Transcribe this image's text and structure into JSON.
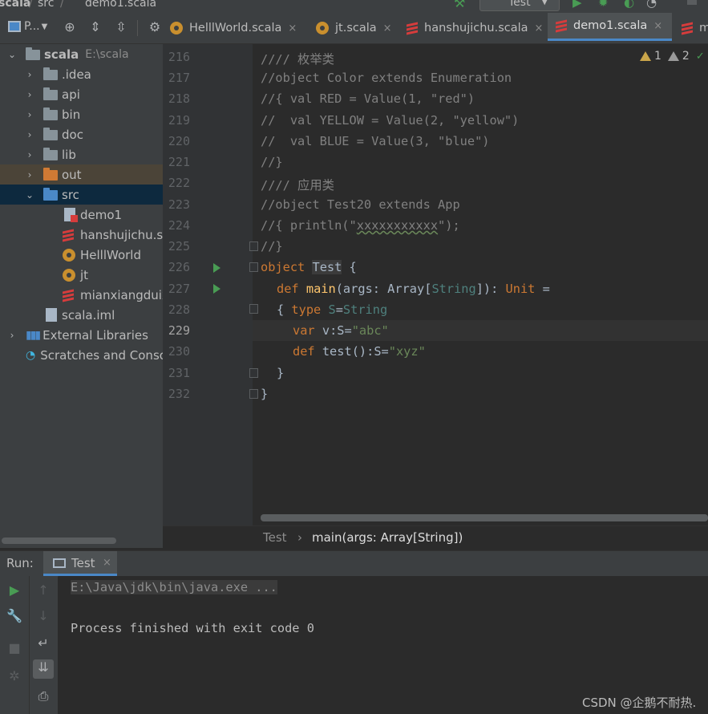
{
  "navbar": {
    "project": "scala",
    "src": "src",
    "file": "demo1.scala",
    "run_config": "Test"
  },
  "toolbar": {
    "project_view_label": "P..."
  },
  "tabs": [
    {
      "label": "HelllWorld.scala",
      "icon": "object-icon",
      "active": false
    },
    {
      "label": "jt.scala",
      "icon": "object-icon",
      "active": false
    },
    {
      "label": "hanshujichu.scala",
      "icon": "scala-file-icon",
      "active": false
    },
    {
      "label": "demo1.scala",
      "icon": "scala-file-icon",
      "active": true
    },
    {
      "label": "m",
      "icon": "scala-file-icon",
      "active": false
    }
  ],
  "tab_close": "×",
  "project_tree": {
    "root": {
      "label": "scala",
      "path": "E:\\scala"
    },
    "items": [
      {
        "label": ".idea"
      },
      {
        "label": "api"
      },
      {
        "label": "bin"
      },
      {
        "label": "doc"
      },
      {
        "label": "lib"
      },
      {
        "label": "out"
      },
      {
        "label": "src"
      },
      {
        "label": "demo1"
      },
      {
        "label": "hanshujichu.sc"
      },
      {
        "label": "HelllWorld"
      },
      {
        "label": "jt"
      },
      {
        "label": "mianxiangduix"
      },
      {
        "label": "scala.iml"
      },
      {
        "label": "External Libraries"
      },
      {
        "label": "Scratches and Conso"
      }
    ]
  },
  "editor": {
    "line_numbers": [
      "216",
      "217",
      "218",
      "219",
      "220",
      "221",
      "222",
      "223",
      "224",
      "225",
      "226",
      "227",
      "228",
      "229",
      "230",
      "231",
      "232"
    ],
    "current_line": "229",
    "lines": {
      "l216": "//// 枚举类",
      "l217": "//object Color extends Enumeration",
      "l218": "//{ val RED = Value(1, \"red\")",
      "l219": "//  val YELLOW = Value(2, \"yellow\")",
      "l220": "//  val BLUE = Value(3, \"blue\")",
      "l221": "//}",
      "l222": "//// 应用类",
      "l223": "//object Test20 extends App",
      "l224a": "//{ println(\"",
      "l224b": "xxxxxxxxxxx",
      "l224c": "\");",
      "l225": "//}",
      "l226": {
        "kw": "object",
        "name": "Test",
        "rest": " {"
      },
      "l227": {
        "kw": "def",
        "name": "main",
        "p1": "(args: Array[",
        "type": "String",
        "p2": "]): ",
        "ret": "Unit",
        "eq": " ="
      },
      "l228": {
        "brace": "{ ",
        "kw": "type",
        "name": " S",
        "eq": "=",
        "type": "String"
      },
      "l229": {
        "kw": "var",
        "name": " v",
        "colon": ":S=",
        "str": "\"abc\""
      },
      "l230": {
        "kw": "def",
        "name": " test",
        "colon": "():S=",
        "str": "\"xyz\""
      },
      "l231": "}",
      "l232": "}"
    },
    "warnings": {
      "yellow_count": "1",
      "gray_count": "2"
    }
  },
  "breadcrumb": {
    "item1": "Test",
    "sep": "›",
    "item2": "main(args: Array[String])"
  },
  "run_panel": {
    "label": "Run:",
    "tab": "Test",
    "console_lines": [
      "E:\\Java\\jdk\\bin\\java.exe ...",
      "",
      "Process finished with exit code 0"
    ]
  },
  "watermark": "CSDN @企鹅不耐热.",
  "colors": {
    "keyword": "#cc7832",
    "string": "#6a8759",
    "comment": "#808080",
    "type": "#4e807d",
    "function": "#ffc66d",
    "run_green": "#499c54",
    "accent": "#4a88c7"
  }
}
